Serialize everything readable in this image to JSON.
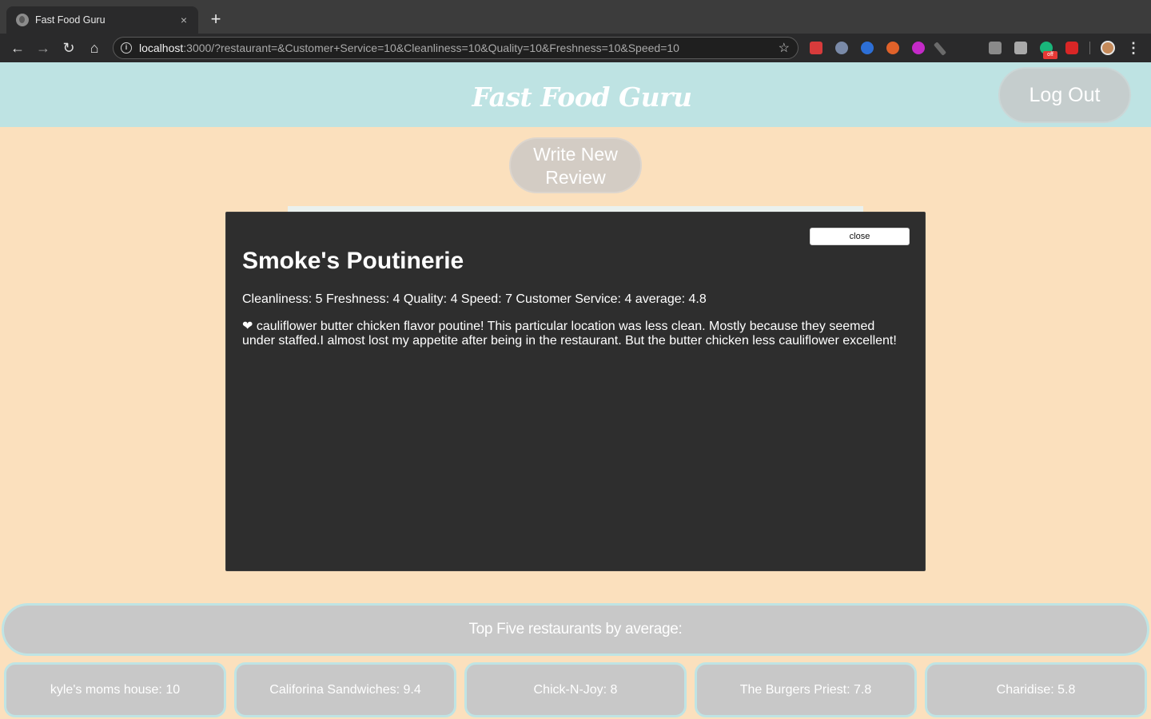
{
  "browser": {
    "tab_title": "Fast Food Guru",
    "tab_close": "×",
    "new_tab": "+",
    "url_host": "localhost",
    "url_rest": ":3000/?restaurant=&Customer+Service=10&Cleanliness=10&Quality=10&Freshness=10&Speed=10",
    "ext_badge": "off",
    "icons": [
      "back-icon",
      "forward-icon",
      "reload-icon",
      "home-icon",
      "info-icon",
      "star-icon",
      "menu-dots-icon"
    ]
  },
  "header": {
    "logo": "Fast Food Guru",
    "logout": "Log Out"
  },
  "actions": {
    "write_review": "Write New Review"
  },
  "modal": {
    "close_label": "close",
    "title": "Smoke's Poutinerie",
    "ratings": "Cleanliness: 5 Freshness: 4 Quality: 4 Speed: 7 Customer Service: 4 average: 4.8",
    "review": "❤ cauliflower butter chicken flavor poutine! This particular location was less clean. Mostly because they seemed under staffed.I almost lost my appetite after being in the restaurant. But the butter chicken less cauliflower excellent!"
  },
  "top_five": {
    "heading": "Top Five restaurants by average:",
    "items": [
      {
        "label": "kyle's moms house: 10"
      },
      {
        "label": "Califorina Sandwiches: 9.4"
      },
      {
        "label": "Chick-N-Joy: 8"
      },
      {
        "label": "The Burgers Priest: 7.8"
      },
      {
        "label": "Charidise: 5.8"
      }
    ]
  },
  "colors": {
    "page_bg": "#fbe0bd",
    "header_bg": "#bee3e3",
    "modal_bg": "#2e2e2e",
    "button_grey": "#c8c8c8",
    "accent_border": "#bfe4e4"
  }
}
